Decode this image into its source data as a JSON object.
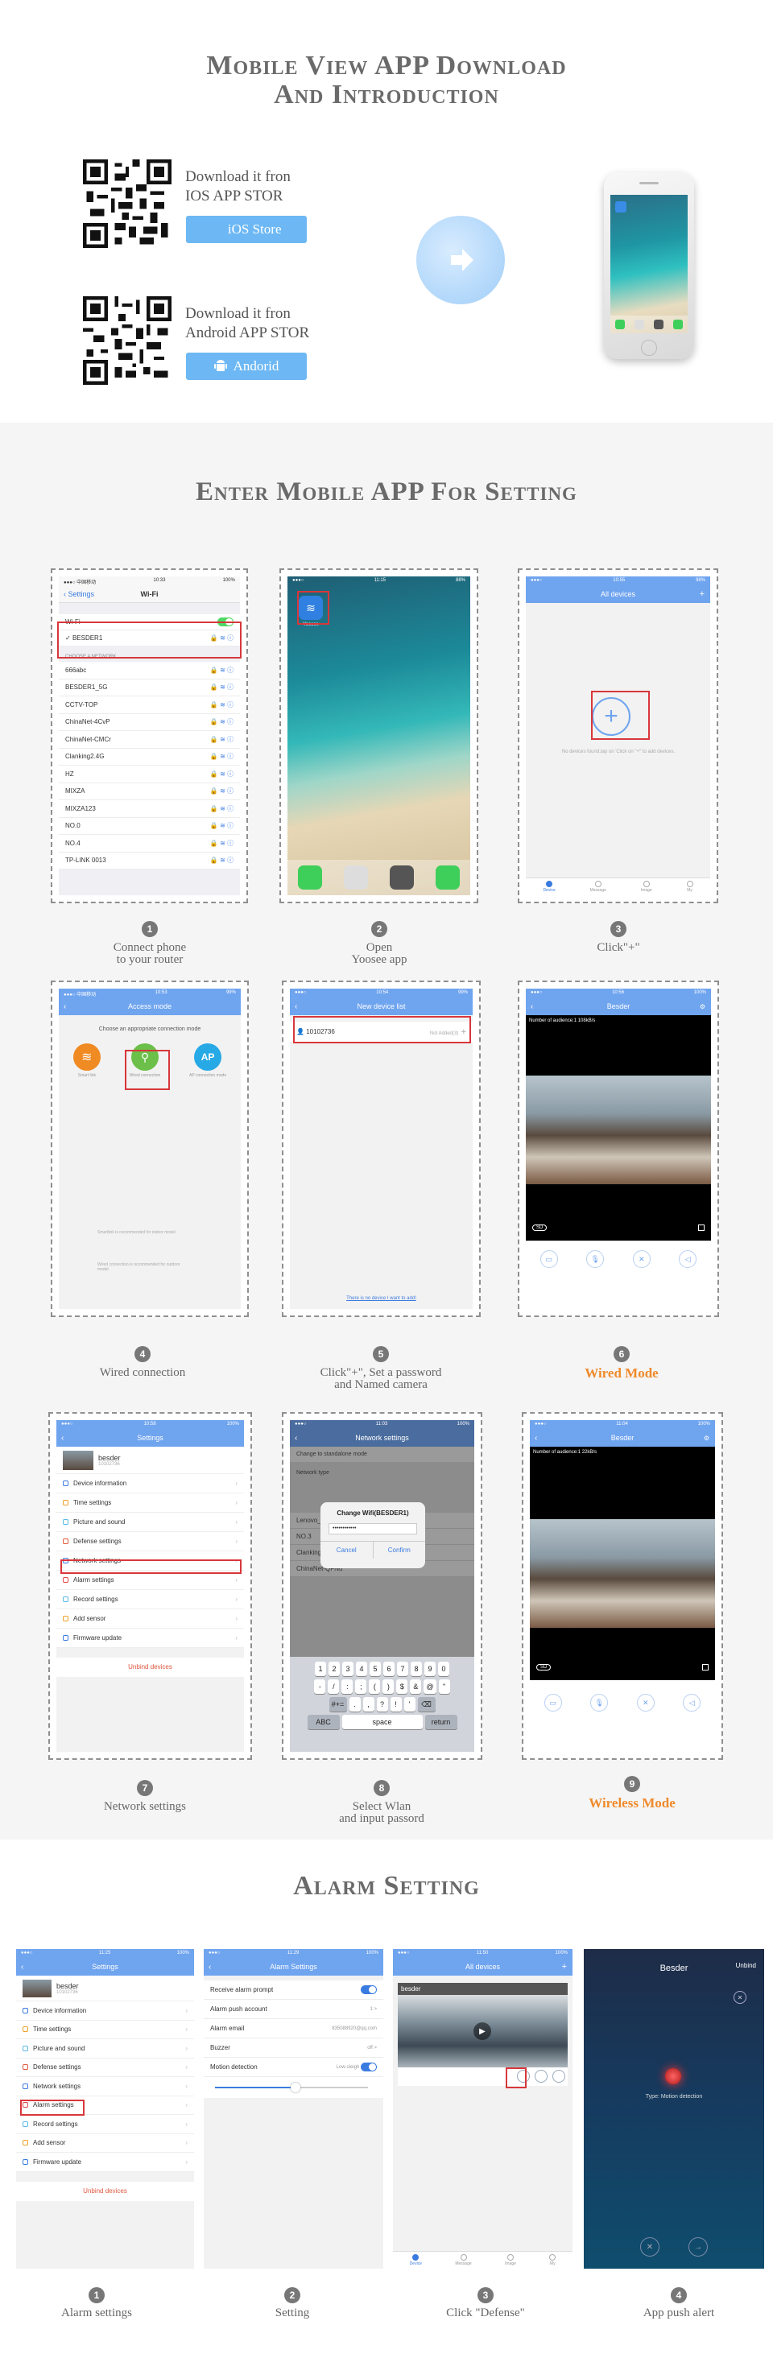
{
  "header": {
    "title_line1": "Mobile View APP Download",
    "title_line2": "And Introduction"
  },
  "download": {
    "ios_line1": "Download it fron",
    "ios_line2": "IOS APP STOR",
    "ios_button": "iOS Store",
    "android_line1": "Download it fron",
    "android_line2": "Android APP STOR",
    "android_button": "Andorid"
  },
  "setting_section": {
    "title": "Enter Mobile APP For Setting"
  },
  "wifi_screen": {
    "back": "Settings",
    "title": "Wi-Fi",
    "wifi_label": "Wi-Fi",
    "connected": "BESDER1",
    "choose": "CHOOSE A NETWORK...",
    "networks": [
      "666abc",
      "BESDER1_5G",
      "CCTV-TOP",
      "ChinaNet-4CvP",
      "ChinaNet-CMCr",
      "Clanking2.4G",
      "HZ",
      "MIXZA",
      "MIXZA123",
      "NO.0",
      "NO.4",
      "TP-LINK 0013"
    ]
  },
  "home_screen": {
    "app_label": "Yoosee"
  },
  "all_devices": {
    "title": "All devices",
    "empty_text": "No devices found,tap on 'Click on \"+\" to add devices.",
    "tabs": [
      "Device",
      "Message",
      "Image",
      "My"
    ]
  },
  "access_mode": {
    "title": "Access mode",
    "subtitle": "Choose an appropriate connection mode",
    "modes": [
      "Smart link",
      "Wired connection",
      "AP connection mode"
    ],
    "note1": "Smartlink is recommended for indoor model",
    "note2": "Wired connection is recommended for outdoor model"
  },
  "new_device": {
    "title": "New device list",
    "device_id": "10102736",
    "status": "Not Added(3)",
    "link": "There is no device I want to add!"
  },
  "live_view": {
    "title": "Besder",
    "audience_wired": "Number of audience:1  108kB/s",
    "audience_wireless": "Number of audience:1  22kB/s",
    "sd": "SD"
  },
  "settings_screen": {
    "title": "Settings",
    "device_name": "besder",
    "device_id": "10102736",
    "items": [
      "Device information",
      "Time settings",
      "Picture and sound",
      "Defense settings",
      "Network settings",
      "Alarm settings",
      "Record settings",
      "Add sensor",
      "Firmware update"
    ],
    "unbind": "Unbind devices"
  },
  "network_screen": {
    "title": "Network settings",
    "change_mode": "Change to standalone mode",
    "network_type": "Network type",
    "dialog_title": "Change Wifi(BESDER1)",
    "password_mask": "••••••••••••",
    "cancel": "Cancel",
    "confirm": "Confirm",
    "list": [
      "Lenovo_339FB8",
      "NO.3",
      "Clanking2.4G",
      "ChinaNet-QFNu"
    ],
    "keys_row1": [
      "1",
      "2",
      "3",
      "4",
      "5",
      "6",
      "7",
      "8",
      "9",
      "0"
    ],
    "keys_row2": [
      "-",
      "/",
      ":",
      ";",
      "(",
      ")",
      "$",
      "&",
      "@",
      "\""
    ],
    "keys_row3": [
      "#+=",
      ".",
      ",",
      "?",
      "!",
      "'",
      "⌫"
    ],
    "key_abc": "ABC",
    "key_space": "space",
    "key_return": "return"
  },
  "steps": [
    {
      "n": "1",
      "caption": "Connect phone\nto your router"
    },
    {
      "n": "2",
      "caption": "Open\nYoosee app"
    },
    {
      "n": "3",
      "caption": "Click\"+\""
    },
    {
      "n": "4",
      "caption": "Wired connection"
    },
    {
      "n": "5",
      "caption": "Click\"+\",  Set a password\nand Named camera"
    },
    {
      "n": "6",
      "caption": "Wired Mode"
    },
    {
      "n": "7",
      "caption": "Network settings"
    },
    {
      "n": "8",
      "caption": "Select Wlan\nand input passord"
    },
    {
      "n": "9",
      "caption": "Wireless Mode"
    }
  ],
  "alarm_section": {
    "title": "Alarm Setting",
    "alarm_settings": {
      "title": "Alarm Settings",
      "prompt": "Receive alarm prompt",
      "push": "Alarm push account",
      "push_val": "1 >",
      "email": "Alarm email",
      "email_val": "835088920@qq.com",
      "buzzer": "Buzzer",
      "buzzer_val": "off >",
      "motion": "Motion detection",
      "motion_val": "Low-sleigh"
    },
    "push_alert": {
      "title": "Besder",
      "unbind": "Unbind",
      "type": "Type: Motion detection"
    },
    "camera_name": "besder",
    "steps": [
      {
        "n": "1",
        "caption": "Alarm settings"
      },
      {
        "n": "2",
        "caption": "Setting"
      },
      {
        "n": "3",
        "caption": "Click \"Defense\""
      },
      {
        "n": "4",
        "caption": "App push alert"
      }
    ]
  },
  "colors": {
    "accent_blue": "#6fa4ef",
    "orange": "#ef8a2b",
    "red": "#d8373b"
  }
}
